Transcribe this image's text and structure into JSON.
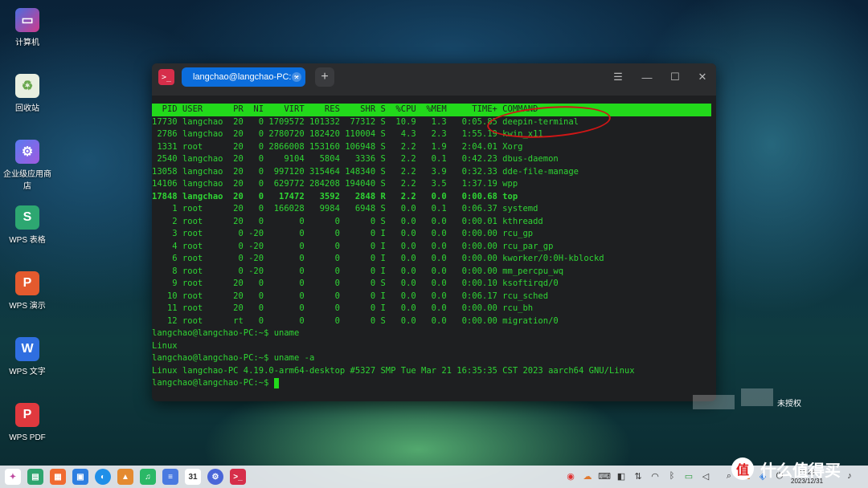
{
  "desktop": {
    "icons": [
      {
        "label": "计算机",
        "icon": "computer-icon",
        "color": "#c83a8c"
      },
      {
        "label": "回收站",
        "icon": "trash-icon",
        "color": "#9fcf5c"
      },
      {
        "label": "企业级应用商店",
        "icon": "app-store-icon",
        "color": "#7a5ad8"
      },
      {
        "label": "WPS 表格",
        "icon": "wps-sheet-icon",
        "color": "#2da771"
      },
      {
        "label": "WPS 演示",
        "icon": "wps-presentation-icon",
        "color": "#e45a2e"
      },
      {
        "label": "WPS 文字",
        "icon": "wps-writer-icon",
        "color": "#2f6ee0"
      },
      {
        "label": "WPS PDF",
        "icon": "wps-pdf-icon",
        "color": "#e0393e"
      }
    ]
  },
  "terminal": {
    "tab_title": "langchao@langchao-PC: ~",
    "new_tab": "+",
    "header": "  PID USER      PR  NI    VIRT    RES    SHR S  %CPU  %MEM     TIME+ COMMAND",
    "rows": [
      "17730 langchao  20   0 1709572 101332  77312 S  10.9   1.3   0:05.85 deepin-terminal",
      " 2786 langchao  20   0 2780720 182420 110004 S   4.3   2.3   1:55.19 kwin_x11",
      " 1331 root      20   0 2866008 153160 106948 S   2.2   1.9   2:04.01 Xorg",
      " 2540 langchao  20   0    9104   5804   3336 S   2.2   0.1   0:42.23 dbus-daemon",
      "13058 langchao  20   0  997120 315464 148340 S   2.2   3.9   0:32.33 dde-file-manage",
      "14106 langchao  20   0  629772 284208 194040 S   2.2   3.5   1:37.19 wpp",
      "17848 langchao  20   0   17472   3592   2848 R   2.2   0.0   0:00.68 top",
      "    1 root      20   0  166028   9984   6948 S   0.0   0.1   0:06.37 systemd",
      "    2 root      20   0       0      0      0 S   0.0   0.0   0:00.01 kthreadd",
      "    3 root       0 -20       0      0      0 I   0.0   0.0   0:00.00 rcu_gp",
      "    4 root       0 -20       0      0      0 I   0.0   0.0   0:00.00 rcu_par_gp",
      "    6 root       0 -20       0      0      0 I   0.0   0.0   0:00.00 kworker/0:0H-kblockd",
      "    8 root       0 -20       0      0      0 I   0.0   0.0   0:00.00 mm_percpu_wq",
      "    9 root      20   0       0      0      0 S   0.0   0.0   0:00.10 ksoftirqd/0",
      "   10 root      20   0       0      0      0 I   0.0   0.0   0:06.17 rcu_sched",
      "   11 root      20   0       0      0      0 I   0.0   0.0   0:00.00 rcu_bh",
      "   12 root      rt   0       0      0      0 S   0.0   0.0   0:00.00 migration/0"
    ],
    "prompt": "langchao@langchao-PC:~$ ",
    "cmd1": "uname",
    "out1": "Linux",
    "cmd2": "uname -a",
    "out2": "Linux langchao-PC 4.19.0-arm64-desktop #5327 SMP Tue Mar 21 16:35:35 CST 2023 aarch64 GNU/Linux"
  },
  "watermark": {
    "label": "未授权"
  },
  "taskbar": {
    "clock_time": "11:23",
    "clock_date": "2023/12/31",
    "calendar_day": "31"
  },
  "brand": {
    "text": "什么值得买",
    "logo": "值"
  }
}
